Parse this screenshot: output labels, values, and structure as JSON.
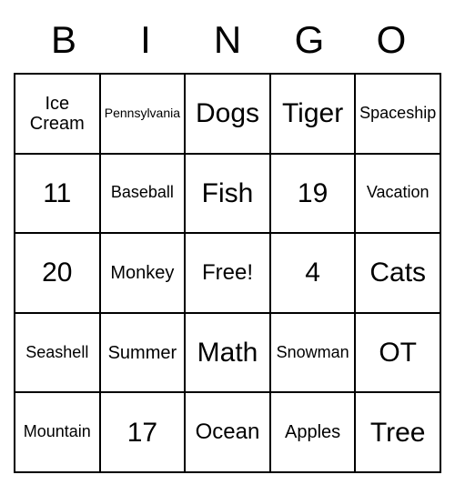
{
  "header": [
    "B",
    "I",
    "N",
    "G",
    "O"
  ],
  "cells": [
    [
      {
        "text": "Ice Cream",
        "size": "fs-medsm"
      },
      {
        "text": "Pennsylvania",
        "size": "fs-xsmall"
      },
      {
        "text": "Dogs",
        "size": "fs-large"
      },
      {
        "text": "Tiger",
        "size": "fs-large"
      },
      {
        "text": "Spaceship",
        "size": "fs-small"
      }
    ],
    [
      {
        "text": "11",
        "size": "fs-large"
      },
      {
        "text": "Baseball",
        "size": "fs-small"
      },
      {
        "text": "Fish",
        "size": "fs-large"
      },
      {
        "text": "19",
        "size": "fs-large"
      },
      {
        "text": "Vacation",
        "size": "fs-small"
      }
    ],
    [
      {
        "text": "20",
        "size": "fs-large"
      },
      {
        "text": "Monkey",
        "size": "fs-medsm"
      },
      {
        "text": "Free!",
        "size": "fs-med"
      },
      {
        "text": "4",
        "size": "fs-large"
      },
      {
        "text": "Cats",
        "size": "fs-large"
      }
    ],
    [
      {
        "text": "Seashell",
        "size": "fs-small"
      },
      {
        "text": "Summer",
        "size": "fs-medsm"
      },
      {
        "text": "Math",
        "size": "fs-large"
      },
      {
        "text": "Snowman",
        "size": "fs-small"
      },
      {
        "text": "OT",
        "size": "fs-large"
      }
    ],
    [
      {
        "text": "Mountain",
        "size": "fs-small"
      },
      {
        "text": "17",
        "size": "fs-large"
      },
      {
        "text": "Ocean",
        "size": "fs-med"
      },
      {
        "text": "Apples",
        "size": "fs-medsm"
      },
      {
        "text": "Tree",
        "size": "fs-large"
      }
    ]
  ]
}
